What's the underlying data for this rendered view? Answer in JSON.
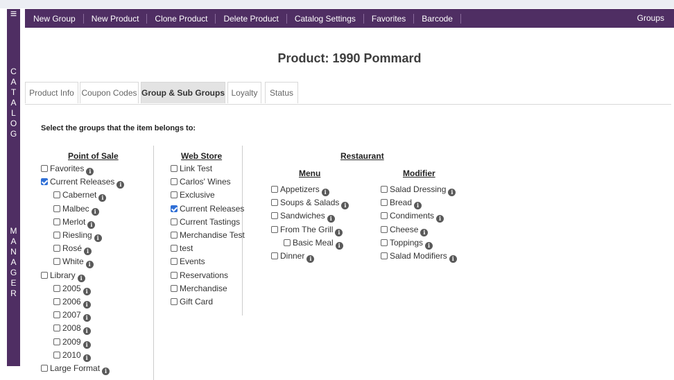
{
  "sidebar": {
    "menu_icon": "≡",
    "word1": [
      "C",
      "A",
      "T",
      "A",
      "L",
      "O",
      "G"
    ],
    "word2": [
      "M",
      "A",
      "N",
      "A",
      "G",
      "E",
      "R"
    ]
  },
  "topnav": {
    "items": [
      "New Group",
      "New Product",
      "Clone Product",
      "Delete Product",
      "Catalog Settings",
      "Favorites",
      "Barcode"
    ],
    "right": "Groups"
  },
  "page_title": "Product: 1990 Pommard",
  "tabs": [
    "Product Info",
    "Coupon Codes",
    "Group & Sub Groups",
    "Loyalty",
    "Status"
  ],
  "active_tab": "Group & Sub Groups",
  "prompt": "Select the groups that the item belongs to:",
  "info_glyph": "i",
  "pos": {
    "header": "Point of Sale",
    "items": [
      {
        "label": "Favorites",
        "checked": false,
        "indent": 0
      },
      {
        "label": "Current Releases",
        "checked": true,
        "indent": 0
      },
      {
        "label": "Cabernet",
        "checked": false,
        "indent": 1
      },
      {
        "label": "Malbec",
        "checked": false,
        "indent": 1
      },
      {
        "label": "Merlot",
        "checked": false,
        "indent": 1
      },
      {
        "label": "Riesling",
        "checked": false,
        "indent": 1
      },
      {
        "label": "Rosé",
        "checked": false,
        "indent": 1
      },
      {
        "label": "White",
        "checked": false,
        "indent": 1
      },
      {
        "label": "Library",
        "checked": false,
        "indent": 0
      },
      {
        "label": "2005",
        "checked": false,
        "indent": 1
      },
      {
        "label": "2006",
        "checked": false,
        "indent": 1
      },
      {
        "label": "2007",
        "checked": false,
        "indent": 1
      },
      {
        "label": "2008",
        "checked": false,
        "indent": 1
      },
      {
        "label": "2009",
        "checked": false,
        "indent": 1
      },
      {
        "label": "2010",
        "checked": false,
        "indent": 1
      },
      {
        "label": "Large Format",
        "checked": false,
        "indent": 0
      }
    ]
  },
  "webstore": {
    "header": "Web Store",
    "items": [
      {
        "label": "Link Test",
        "checked": false
      },
      {
        "label": "Carlos' Wines",
        "checked": false
      },
      {
        "label": "Exclusive",
        "checked": false
      },
      {
        "label": "Current Releases",
        "checked": true
      },
      {
        "label": "Current Tastings",
        "checked": false
      },
      {
        "label": "Merchandise Test",
        "checked": false
      },
      {
        "label": "test",
        "checked": false
      },
      {
        "label": "Events",
        "checked": false
      },
      {
        "label": "Reservations",
        "checked": false
      },
      {
        "label": "Merchandise",
        "checked": false
      },
      {
        "label": "Gift Card",
        "checked": false
      }
    ]
  },
  "restaurant": {
    "header": "Restaurant",
    "menu": {
      "header": "Menu",
      "items": [
        {
          "label": "Appetizers",
          "checked": false,
          "indent": 0
        },
        {
          "label": "Soups & Salads",
          "checked": false,
          "indent": 0
        },
        {
          "label": "Sandwiches",
          "checked": false,
          "indent": 0
        },
        {
          "label": "From The Grill",
          "checked": false,
          "indent": 0
        },
        {
          "label": "Basic Meal",
          "checked": false,
          "indent": 1
        },
        {
          "label": "Dinner",
          "checked": false,
          "indent": 0
        }
      ]
    },
    "modifier": {
      "header": "Modifier",
      "items": [
        {
          "label": "Salad Dressing",
          "checked": false
        },
        {
          "label": "Bread",
          "checked": false
        },
        {
          "label": "Condiments",
          "checked": false
        },
        {
          "label": "Cheese",
          "checked": false
        },
        {
          "label": "Toppings",
          "checked": false
        },
        {
          "label": "Salad Modifiers",
          "checked": false
        }
      ]
    }
  },
  "colors": {
    "brand": "#4f2e63",
    "checkbox_checked": "#2f6fd6"
  }
}
